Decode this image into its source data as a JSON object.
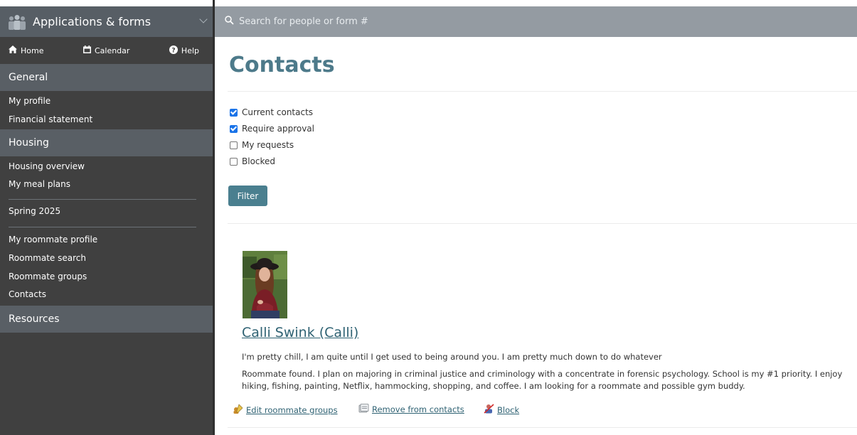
{
  "app": {
    "title": "Applications & forms"
  },
  "search": {
    "placeholder": "Search for people or form #"
  },
  "topnav": {
    "home": "Home",
    "calendar": "Calendar",
    "help": "Help"
  },
  "sidebar": {
    "general": {
      "title": "General",
      "items": [
        "My profile",
        "Financial statement"
      ]
    },
    "housing": {
      "title": "Housing",
      "items": [
        "Housing overview",
        "My meal plans"
      ],
      "term": "Spring 2025",
      "roommate_items": [
        "My roommate profile",
        "Roommate search",
        "Roommate groups",
        "Contacts"
      ]
    },
    "resources": {
      "title": "Resources"
    }
  },
  "main": {
    "title": "Contacts",
    "filters": [
      {
        "label": "Current contacts",
        "checked": true
      },
      {
        "label": "Require approval",
        "checked": true
      },
      {
        "label": "My requests",
        "checked": false
      },
      {
        "label": "Blocked",
        "checked": false
      }
    ],
    "filter_button": "Filter",
    "contact": {
      "name": "Calli Swink (Calli)",
      "tagline": "I'm pretty chill, I am quite until I get used to being around you. I am pretty much down to do whatever",
      "bio": "Roommate found. I plan on majoring in criminal justice and criminology with a concentrate in forensic psychology. School is my #1 priority. I enjoy hiking, fishing, painting, Netflix, hammocking, shopping, and coffee. I am looking for a roommate and possible gym buddy.",
      "actions": {
        "edit_groups": "Edit roommate groups",
        "remove": "Remove from contacts",
        "block": "Block"
      }
    }
  },
  "colors": {
    "sidebar_bg": "#404040",
    "section_header_bg": "#595f65",
    "search_bar_bg": "#949ba2",
    "title_color": "#4d7a8a",
    "button_bg": "#4a7f8f",
    "link_color": "#2f6273"
  },
  "icons": {
    "app": "people-group-icon",
    "home": "home-icon",
    "calendar": "calendar-icon",
    "help": "question-circle-icon",
    "search": "search-icon",
    "edit_groups": "edit-group-icon",
    "remove": "remove-contact-icon",
    "block": "block-user-icon"
  }
}
